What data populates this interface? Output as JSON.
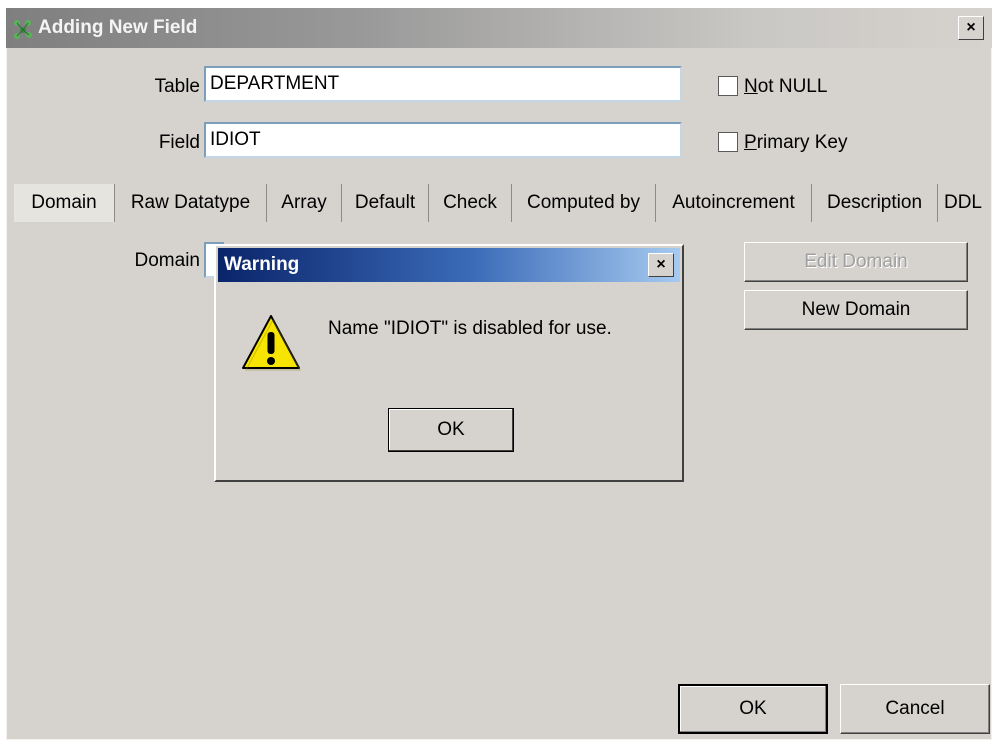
{
  "window": {
    "title": "Adding New Field",
    "close_glyph": "×",
    "icon": "app-icon"
  },
  "form": {
    "table_label": "Table",
    "table_value": "DEPARTMENT",
    "field_label": "Field",
    "field_value": "IDIOT",
    "not_null_label": "Not NULL",
    "not_null_checked": false,
    "primary_key_label": "Primary Key",
    "primary_key_checked": false
  },
  "tabs": [
    {
      "label": "Domain",
      "active": true
    },
    {
      "label": "Raw Datatype"
    },
    {
      "label": "Array"
    },
    {
      "label": "Default"
    },
    {
      "label": "Check"
    },
    {
      "label": "Computed by"
    },
    {
      "label": "Autoincrement"
    },
    {
      "label": "Description"
    },
    {
      "label": "DDL"
    }
  ],
  "domain_tab": {
    "domain_label": "Domain",
    "edit_domain_label": "Edit Domain",
    "edit_domain_enabled": false,
    "new_domain_label": "New Domain"
  },
  "warning": {
    "title": "Warning",
    "message": "Name \"IDIOT\" is disabled for use.",
    "ok_label": "OK",
    "close_glyph": "×",
    "icon": "warning-icon"
  },
  "footer": {
    "ok_label": "OK",
    "cancel_label": "Cancel"
  },
  "colors": {
    "dialog_bg": "#d6d3ce",
    "warning_title": "#0a246a",
    "input_border": "#7b9ebd"
  }
}
